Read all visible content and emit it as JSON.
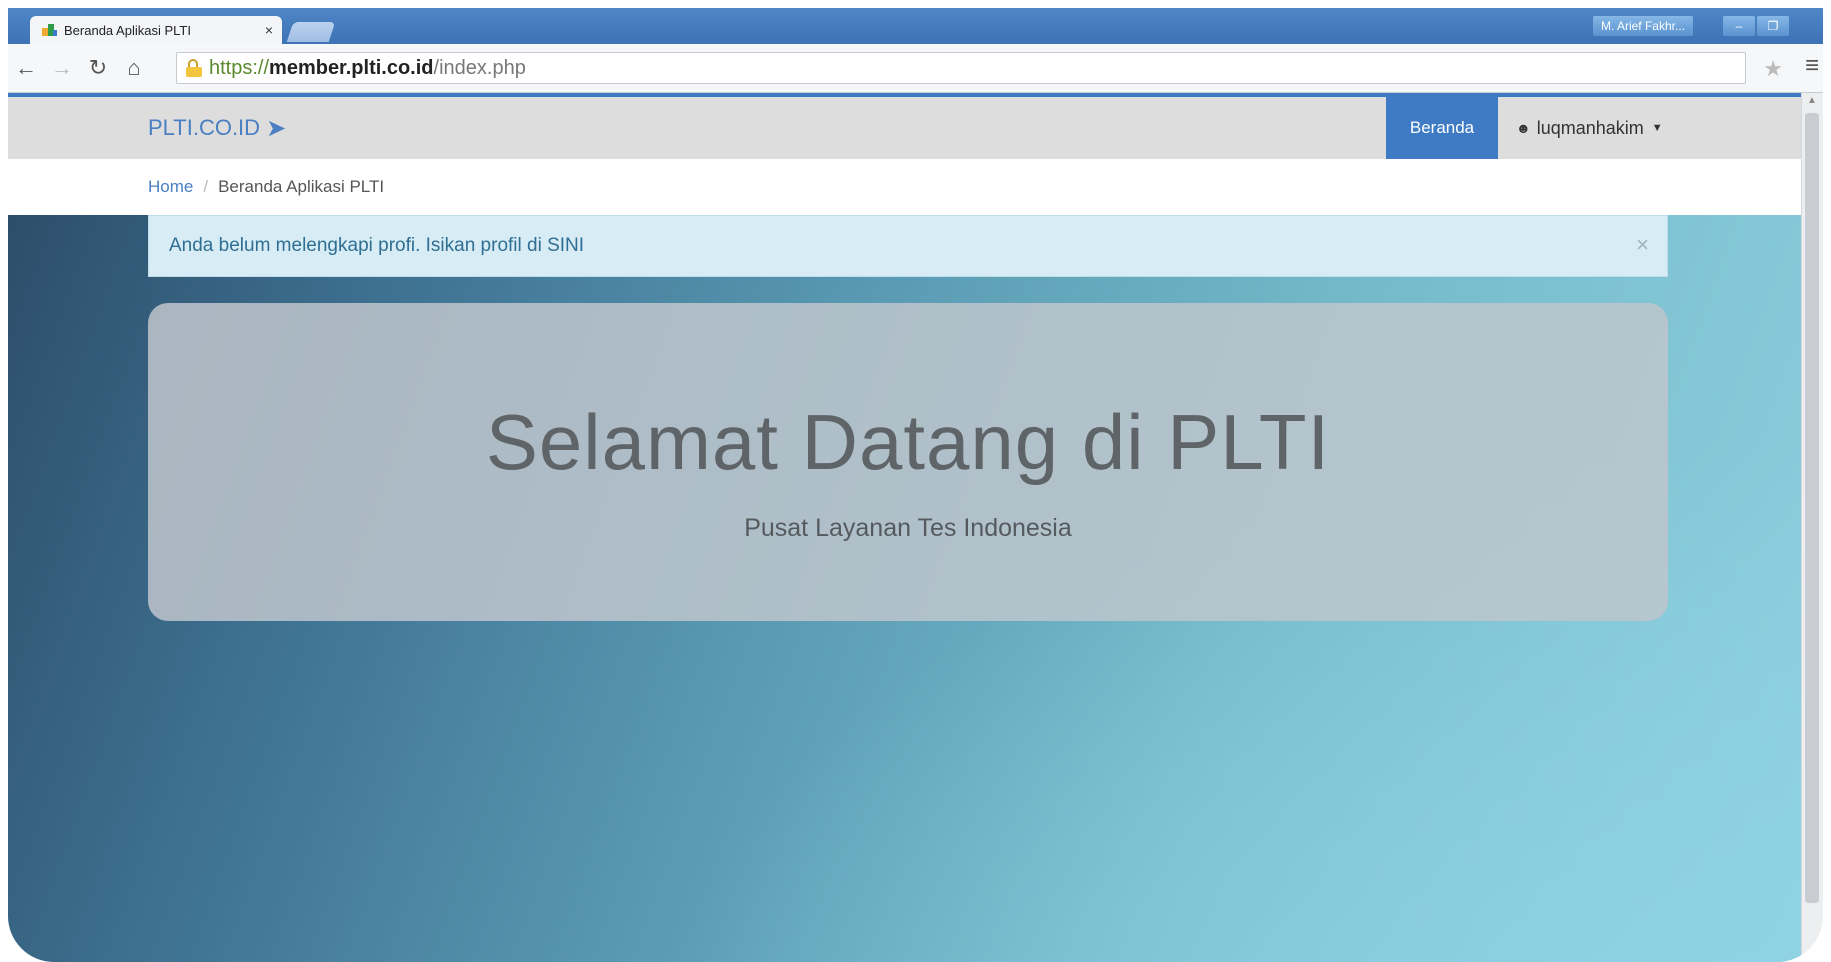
{
  "browser": {
    "tab_title": "Beranda Aplikasi PLTI",
    "tab_close": "×",
    "user_chip": "M. Arief Fakhr...",
    "window_min": "–",
    "window_restore": "❐",
    "url_scheme": "https://",
    "url_host": "member.plti.co.id",
    "url_path": "/index.php",
    "icons": {
      "back": "back-arrow-icon",
      "forward": "forward-arrow-icon",
      "reload": "reload-icon",
      "home": "home-icon",
      "lock": "lock-icon",
      "star": "bookmark-star-icon",
      "menu": "menu-icon"
    }
  },
  "navbar": {
    "brand": "PLTI.CO.ID",
    "brand_icon": "paper-plane-icon",
    "active_item": "Beranda",
    "user_name": "luqmanhakim",
    "user_icon": "user-icon"
  },
  "breadcrumb": {
    "home": "Home",
    "separator": "/",
    "current": "Beranda Aplikasi PLTI"
  },
  "alert": {
    "message": "Anda belum melengkapi profi. Isikan profil di SINI",
    "close": "×"
  },
  "hero": {
    "title": "Selamat Datang di PLTI",
    "subtitle": "Pusat Layanan Tes Indonesia"
  },
  "colors": {
    "accent": "#3e7bc4",
    "alert_bg": "#d8ecf5",
    "alert_text": "#2f6f93"
  }
}
